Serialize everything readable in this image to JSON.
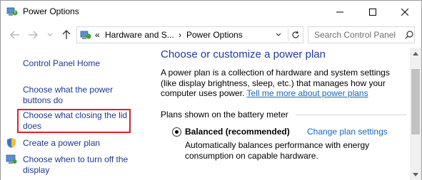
{
  "window": {
    "title": "Power Options"
  },
  "address_bar": {
    "overflow_chevron": "«",
    "breadcrumbs": [
      "Hardware and S...",
      "Power Options"
    ],
    "separator": "›"
  },
  "search": {
    "placeholder": "Search Control Panel"
  },
  "sidebar": {
    "items": [
      {
        "label": "Control Panel Home"
      },
      {
        "label": "Choose what the power buttons do"
      },
      {
        "label": "Choose what closing the lid does"
      },
      {
        "label": "Create a power plan",
        "icon": "shield-icon"
      },
      {
        "label": "Choose when to turn off the display",
        "icon": "display-icon"
      }
    ]
  },
  "main": {
    "title": "Choose or customize a power plan",
    "description": "A power plan is a collection of hardware and system settings (like display brightness, sleep, etc.) that manages how your computer uses power. ",
    "description_link": "Tell me more about power plans",
    "section_label": "Plans shown on the battery meter",
    "plan": {
      "name": "Balanced (recommended)",
      "change_link": "Change plan settings",
      "description": "Automatically balances performance with energy consumption on capable hardware.",
      "selected": true
    }
  },
  "colors": {
    "link": "#1b3a8c",
    "title_blue": "#1e3c96",
    "highlight": "#e0202a"
  }
}
